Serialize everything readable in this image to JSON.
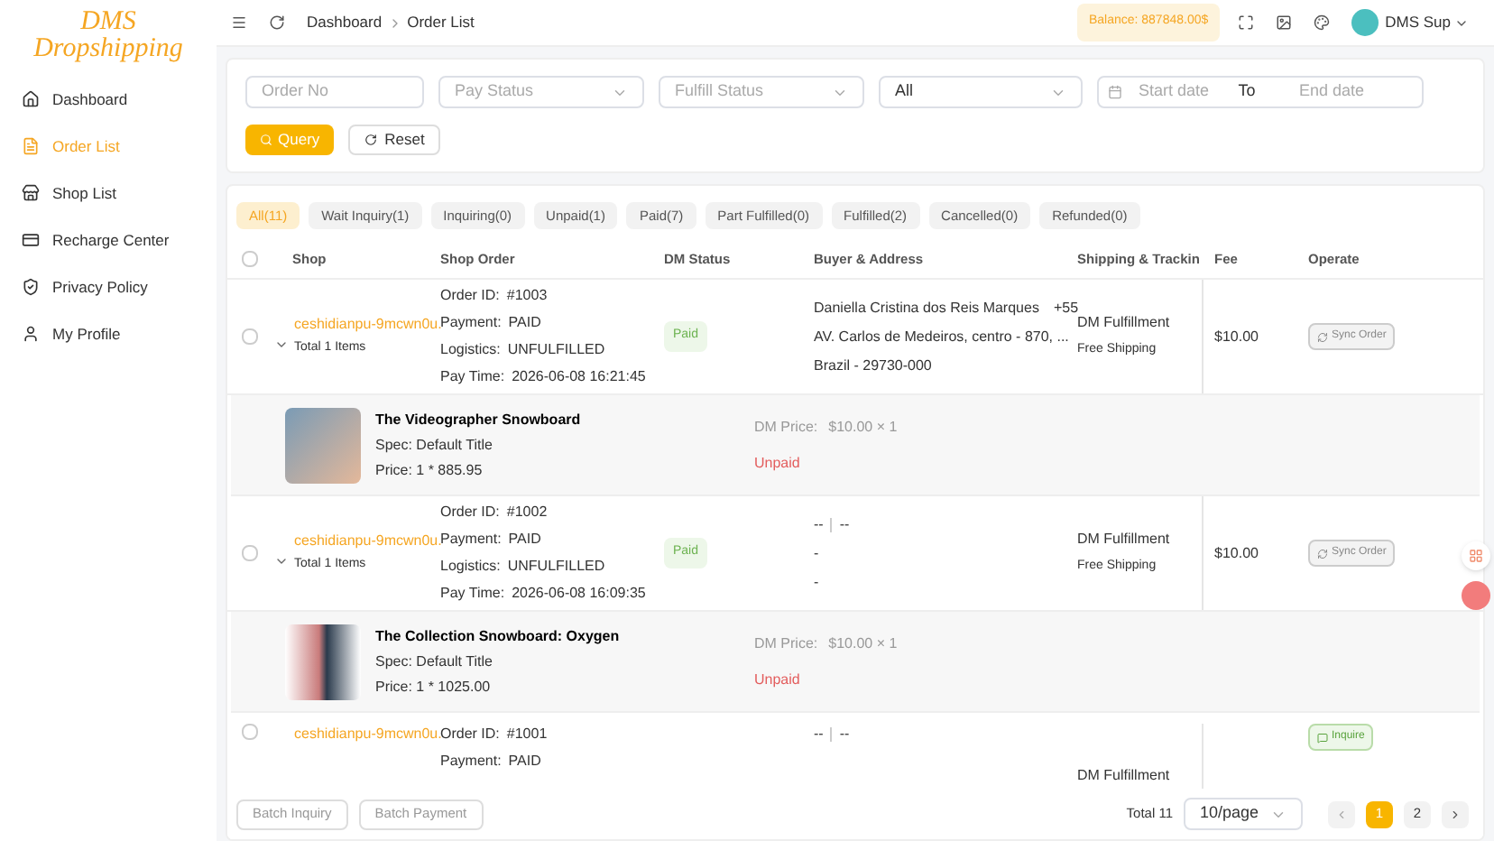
{
  "logo": {
    "line1": "DMS",
    "line2": "Dropshipping"
  },
  "sidebar": {
    "items": [
      {
        "label": "Dashboard",
        "selected": false
      },
      {
        "label": "Order List",
        "selected": true
      },
      {
        "label": "Shop List",
        "selected": false
      },
      {
        "label": "Recharge Center",
        "selected": false
      },
      {
        "label": "Privacy Policy",
        "selected": false
      },
      {
        "label": "My Profile",
        "selected": false
      }
    ]
  },
  "breadcrumb": [
    "Dashboard",
    "Order List"
  ],
  "balance": "Balance: 887848.00$",
  "user": "DMS Sup",
  "filters": {
    "order_no": {
      "placeholder": "Order No"
    },
    "pay_status": {
      "placeholder": "Pay Status"
    },
    "fulfill_status": {
      "placeholder": "Fulfill Status"
    },
    "type": {
      "value": "All"
    },
    "start_date": {
      "placeholder": "Start date"
    },
    "range_sep": "To",
    "end_date": {
      "placeholder": "End date"
    },
    "query": "Query",
    "reset": "Reset"
  },
  "tabs": [
    {
      "label": "All(11)",
      "selected": true
    },
    {
      "label": "Wait Inquiry(1)",
      "selected": false
    },
    {
      "label": "Inquiring(0)",
      "selected": false
    },
    {
      "label": "Unpaid(1)",
      "selected": false
    },
    {
      "label": "Paid(7)",
      "selected": false
    },
    {
      "label": "Part Fulfilled(0)",
      "selected": false
    },
    {
      "label": "Fulfilled(2)",
      "selected": false
    },
    {
      "label": "Cancelled(0)",
      "selected": false
    },
    {
      "label": "Refunded(0)",
      "selected": false
    }
  ],
  "table": {
    "select_all_checked": false,
    "columns": [
      "Shop",
      "Shop Order",
      "DM Status",
      "Buyer & Address",
      "Shipping & Trackin",
      "Fee",
      "Operate"
    ],
    "orders": [
      {
        "checked": false,
        "expanded": true,
        "shop": "ceshidianpu-9mcwn0u.",
        "items": "Total 1 Items",
        "order_lines": [
          [
            "Order ID:",
            "#1003"
          ],
          [
            "Payment:",
            "PAID"
          ],
          [
            "Logistics:",
            "UNFULFILLED"
          ],
          [
            "Pay Time:",
            "2026-06-08 16:21:45"
          ]
        ],
        "dm_status": "Paid",
        "buyer": {
          "name": "Daniella Cristina dos Reis Marques",
          "phone": "+55",
          "address": "AV. Carlos de Medeiros, centro - 870, ...",
          "country": "Brazil - 29730-000"
        },
        "shipping": "DM Fulfillment",
        "shipping_note": "Free Shipping",
        "fee": "$10.00",
        "action": {
          "kind": "sync",
          "label": "Sync Order"
        },
        "product": {
          "title": "The Videographer Snowboard",
          "spec": "Spec: Default Title",
          "price": "Price: 1 * 885.95",
          "dm_price_label": "DM Price:",
          "dm_price": "$10.00 × 1",
          "status": "Unpaid"
        }
      },
      {
        "checked": false,
        "expanded": true,
        "shop": "ceshidianpu-9mcwn0u.",
        "items": "Total 1 Items",
        "order_lines": [
          [
            "Order ID:",
            "#1002"
          ],
          [
            "Payment:",
            "PAID"
          ],
          [
            "Logistics:",
            "UNFULFILLED"
          ],
          [
            "Pay Time:",
            "2026-06-08 16:09:35"
          ]
        ],
        "dm_status": "Paid",
        "buyer": {
          "name": "--",
          "phone": "--",
          "address": "-",
          "country": "-"
        },
        "shipping": "DM Fulfillment",
        "shipping_note": "Free Shipping",
        "fee": "$10.00",
        "action": {
          "kind": "sync",
          "label": "Sync Order"
        },
        "product": {
          "title": "The Collection Snowboard: Oxygen",
          "spec": "Spec: Default Title",
          "price": "Price: 1 * 1025.00",
          "dm_price_label": "DM Price:",
          "dm_price": "$10.00 × 1",
          "status": "Unpaid"
        }
      },
      {
        "checked": false,
        "shop": "ceshidianpu-9mcwn0u.",
        "order_lines": [
          [
            "Order ID:",
            "#1001"
          ],
          [
            "Payment:",
            "PAID"
          ]
        ],
        "buyer": {
          "name": "--",
          "phone": "--"
        },
        "shipping": "DM Fulfillment",
        "action": {
          "kind": "inquire",
          "label": "Inquire"
        }
      }
    ]
  },
  "footer": {
    "batch_inquiry": "Batch Inquiry",
    "batch_payment": "Batch Payment",
    "total": "Total 11",
    "page_size": "10/page",
    "pages": [
      {
        "label": "1",
        "selected": true
      },
      {
        "label": "2",
        "selected": false
      }
    ]
  }
}
